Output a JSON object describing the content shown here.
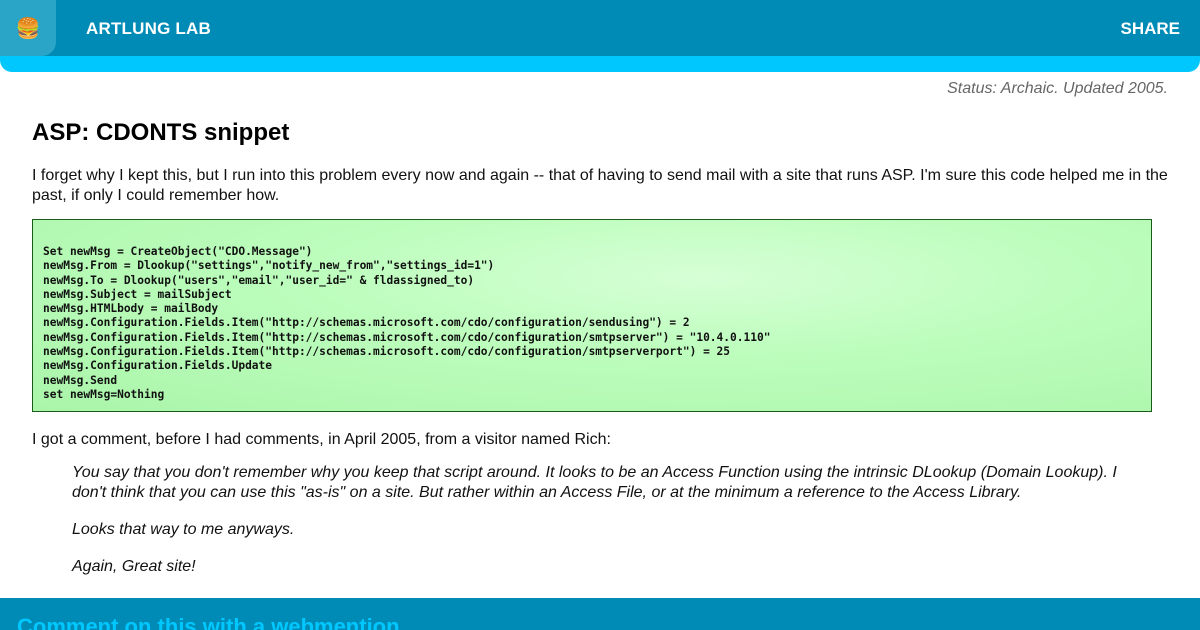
{
  "header": {
    "menu_icon": "hamburger-icon",
    "brand": "ARTLUNG LAB",
    "share": "SHARE"
  },
  "status": "Status: Archaic. Updated 2005.",
  "article": {
    "title": "ASP: CDONTS snippet",
    "intro": "I forget why I kept this, but I run into this problem every now and again -- that of having to send mail with a site that runs ASP. I'm sure this code helped me in the past, if only I could remember how.",
    "code_lines": [
      "Set newMsg = CreateObject(\"CDO.Message\")",
      "newMsg.From = Dlookup(\"settings\",\"notify_new_from\",\"settings_id=1\")",
      "newMsg.To = Dlookup(\"users\",\"email\",\"user_id=\" & fldassigned_to)",
      "newMsg.Subject = mailSubject",
      "newMsg.HTMLbody = mailBody",
      "newMsg.Configuration.Fields.Item(\"http://schemas.microsoft.com/cdo/configuration/sendusing\") = 2",
      "newMsg.Configuration.Fields.Item(\"http://schemas.microsoft.com/cdo/configuration/smtpserver\") = \"10.4.0.110\"",
      "newMsg.Configuration.Fields.Item(\"http://schemas.microsoft.com/cdo/configuration/smtpserverport\") = 25",
      "newMsg.Configuration.Fields.Update",
      "newMsg.Send",
      "set newMsg=Nothing"
    ],
    "comment_intro": "I got a comment, before I had comments, in April 2005, from a visitor named Rich:",
    "quote": [
      "You say that you don't remember why you keep that script around. It looks to be an Access Function using the intrinsic DLookup (Domain Lookup). I don't think that you can use this \"as-is\" on a site. But rather within an Access File, or at the minimum a reference to the Access Library.",
      "Looks that way to me anyways.",
      "Again, Great site!"
    ]
  },
  "footer": {
    "heading": "Comment on this with a webmention"
  },
  "colors": {
    "header_bar": "#008bb6",
    "header_accent": "#00c8ff",
    "code_bg": "#bdfdbd"
  }
}
